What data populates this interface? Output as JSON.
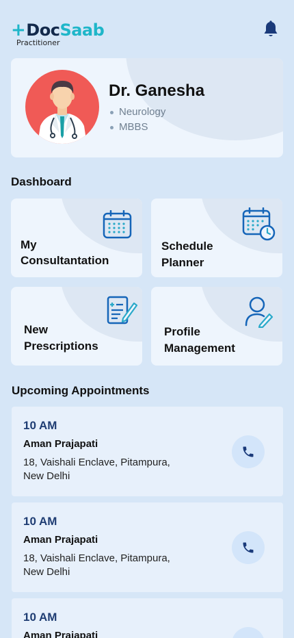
{
  "app": {
    "logo_plus": "+",
    "logo_doc": "Doc",
    "logo_saab": "Saab",
    "logo_subtitle": "Practitioner"
  },
  "doctor": {
    "name": "Dr. Ganesha",
    "specialty": "Neurology",
    "degree": "MBBS"
  },
  "dashboard": {
    "title": "Dashboard",
    "tiles": [
      {
        "label_line1": "My",
        "label_line2": "Consultantation",
        "icon": "calendar-icon"
      },
      {
        "label_line1": "Schedule",
        "label_line2": "Planner",
        "icon": "calendar-clock-icon"
      },
      {
        "label_line1": "New",
        "label_line2": "Prescriptions",
        "icon": "prescription-edit-icon"
      },
      {
        "label_line1": "Profile",
        "label_line2": "Management",
        "icon": "user-edit-icon"
      }
    ]
  },
  "appointments": {
    "title": "Upcoming Appointments",
    "items": [
      {
        "time": "10 AM",
        "name": "Aman Prajapati",
        "address_line1": "18, Vaishali Enclave, Pitampura,",
        "address_line2": "New Delhi"
      },
      {
        "time": "10 AM",
        "name": "Aman Prajapati",
        "address_line1": "18, Vaishali Enclave, Pitampura,",
        "address_line2": "New Delhi"
      },
      {
        "time": "10 AM",
        "name": "Aman Prajapati",
        "address_line1": "",
        "address_line2": ""
      }
    ]
  },
  "colors": {
    "background": "#d6e6f7",
    "card": "#eef5fd",
    "accent_teal": "#1fb6c9",
    "navy": "#13294b",
    "icon_blue": "#1565b8",
    "avatar_red": "#f05a56"
  }
}
